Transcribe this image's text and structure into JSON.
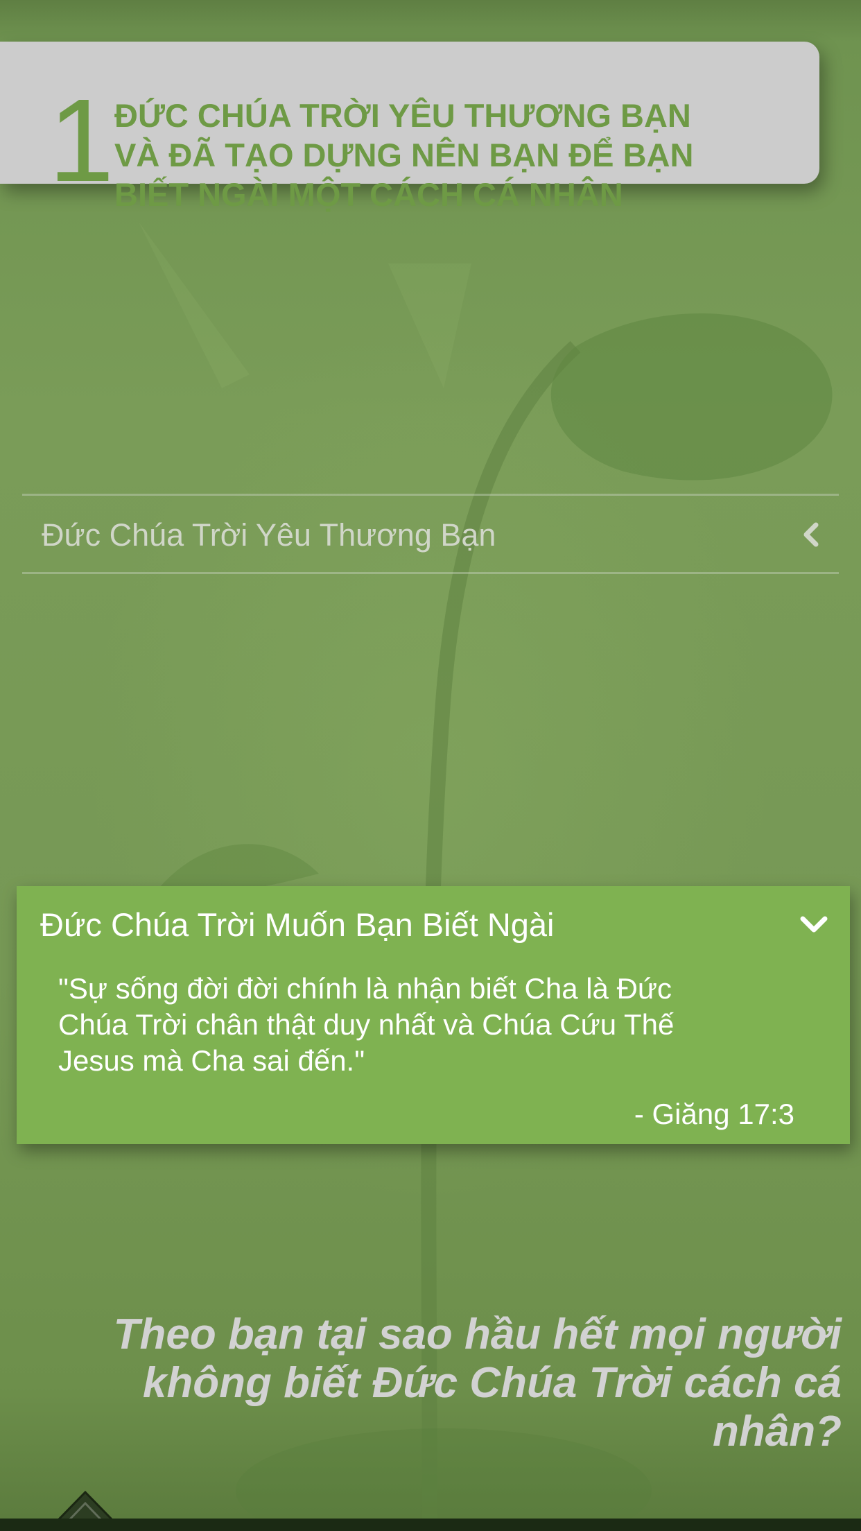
{
  "header": {
    "number": "1",
    "title_lines": [
      "ĐỨC CHÚA TRỜI YÊU THƯƠNG BẠN",
      "VÀ ĐÃ TẠO DỰNG NÊN BẠN ĐỂ BẠN",
      "BIẾT NGÀI MỘT CÁCH CÁ NHÂN"
    ]
  },
  "collapsed_section": {
    "label": "Đức Chúa Trời Yêu Thương Bạn",
    "icon": "chevron-left-icon"
  },
  "expanded_section": {
    "title": "Đức Chúa Trời Muốn Bạn Biết Ngài",
    "icon": "chevron-down-icon",
    "quote_lines": [
      "\"Sự sống đời đời chính là nhận biết Cha là Đức",
      "Chúa Trời chân thật duy nhất và Chúa Cứu Thế",
      "Jesus mà Cha sai đến.\""
    ],
    "reference": "- Giăng 17:3"
  },
  "question": {
    "lines": [
      "Theo bạn tại sao hầu hết mọi người",
      "không biết Đức Chúa Trời cách cá",
      "nhân?"
    ]
  },
  "bottom_tab": {
    "icon": "chevron-up-icon"
  },
  "colors": {
    "background": "#7a9c55",
    "header_card": "#cccccc",
    "header_text": "#6e9a45",
    "panel": "#7fb251",
    "panel_text": "#ffffff",
    "muted_text": "#d0d6c8",
    "question_text": "#d2d2d2"
  }
}
